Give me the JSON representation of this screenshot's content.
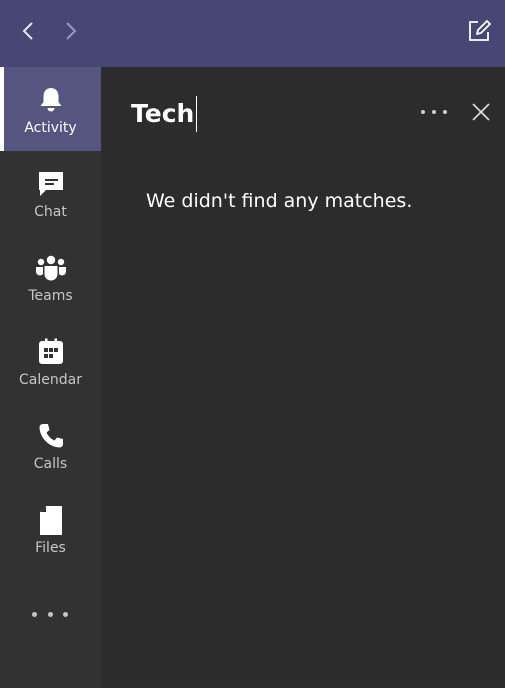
{
  "nav": {
    "back_icon": "chevron-left-icon",
    "forward_icon": "chevron-right-icon",
    "compose_icon": "new-chat-icon"
  },
  "colors": {
    "topbar": "#464775",
    "rail": "#333232",
    "panel": "#2d2c2c",
    "active_item": "#55557f"
  },
  "rail": {
    "items": [
      {
        "label": "Activity",
        "icon": "bell-icon",
        "active": true
      },
      {
        "label": "Chat",
        "icon": "chat-icon",
        "active": false
      },
      {
        "label": "Teams",
        "icon": "teams-icon",
        "active": false
      },
      {
        "label": "Calendar",
        "icon": "calendar-icon",
        "active": false
      },
      {
        "label": "Calls",
        "icon": "phone-icon",
        "active": false
      },
      {
        "label": "Files",
        "icon": "file-icon",
        "active": false
      }
    ],
    "more_icon": "ellipsis-icon"
  },
  "panel": {
    "search_query": "Tech",
    "empty_message": "We didn't find any matches.",
    "more_icon": "ellipsis-icon",
    "close_icon": "close-icon"
  }
}
